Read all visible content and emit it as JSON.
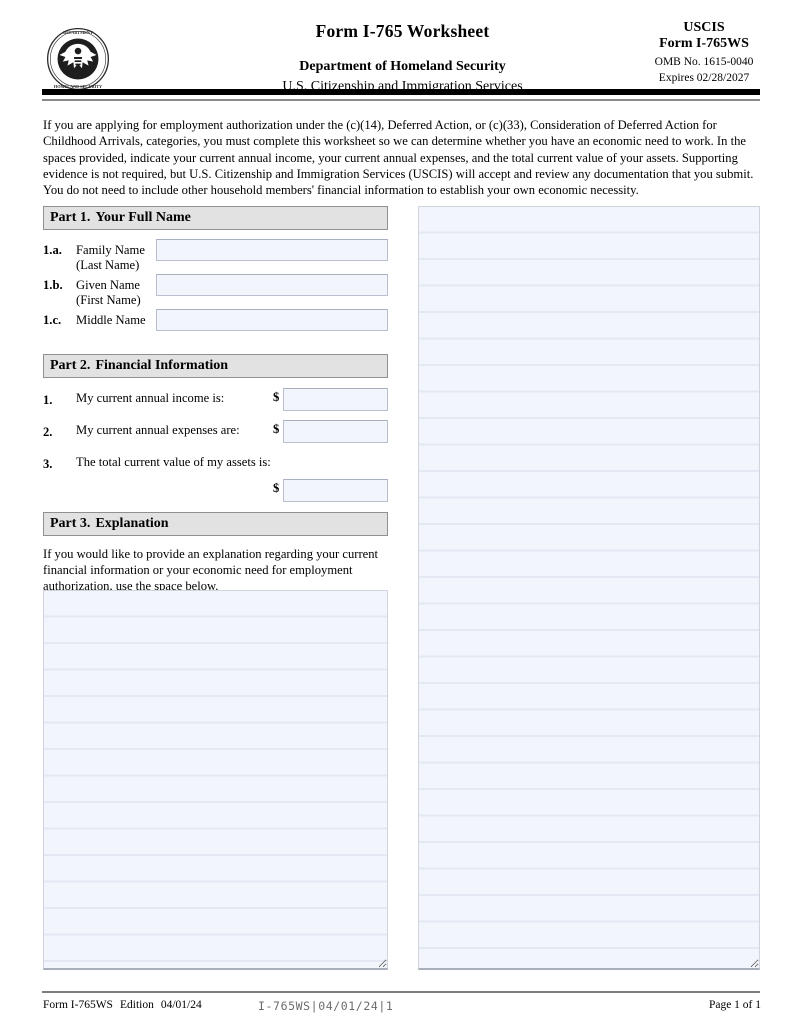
{
  "header": {
    "seal_alt": "Department of Homeland Security seal",
    "form_title": "Form I-765 Worksheet",
    "department": "Department of Homeland Security",
    "agency": "U.S. Citizenship and Immigration Services",
    "uscis_label": "USCIS",
    "form_number": "Form I-765WS",
    "omb": "OMB No. 1615-0040",
    "expires": "Expires 02/28/2027"
  },
  "intro": {
    "paragraph": "If you are applying for employment authorization under the (c)(14), Deferred Action, or (c)(33), Consideration of Deferred Action for Childhood Arrivals, categories, you must complete this worksheet so we can determine whether you have an economic need to work. In the spaces provided, indicate your current annual income, your current annual expenses, and the total current value of your assets. Supporting evidence is not required, but U.S. Citizenship and Immigration Services (USCIS) will accept and review any documentation that you submit.  You do not need to include other household members' financial information to establish your own economic necessity."
  },
  "part1": {
    "number": "Part 1.",
    "title": "Your Full Name",
    "items": [
      {
        "num": "1.a.",
        "label": "Family Name",
        "sublabel": "(Last Name)",
        "value": "",
        "placeholder": ""
      },
      {
        "num": "1.b.",
        "label": "Given Name",
        "sublabel": "(First Name)",
        "value": "",
        "placeholder": ""
      },
      {
        "num": "1.c.",
        "label": "Middle Name",
        "sublabel": "",
        "value": "",
        "placeholder": ""
      }
    ]
  },
  "part2": {
    "number": "Part 2.",
    "title": "Financial Information",
    "currency_symbol": "$",
    "items": [
      {
        "num": "1.",
        "label": "My current annual income is:",
        "value": "",
        "placeholder": ""
      },
      {
        "num": "2.",
        "label": "My current annual expenses are:",
        "value": "",
        "placeholder": ""
      },
      {
        "num": "3.",
        "label": "The total current value of my assets is:",
        "value": "",
        "placeholder": ""
      }
    ]
  },
  "part3": {
    "number": "Part 3.",
    "title": "Explanation",
    "instruction": "If you would like to provide an explanation regarding your current financial information or your economic need for employment authorization, use the space below.",
    "left_area_value": "",
    "right_area_value": ""
  },
  "footer": {
    "form_name": "Form I-765WS",
    "edition_label": "Edition",
    "edition_date": "04/01/24",
    "barcode_text": "I-765WS|04/01/24|1",
    "page": "Page 1 of 1"
  }
}
